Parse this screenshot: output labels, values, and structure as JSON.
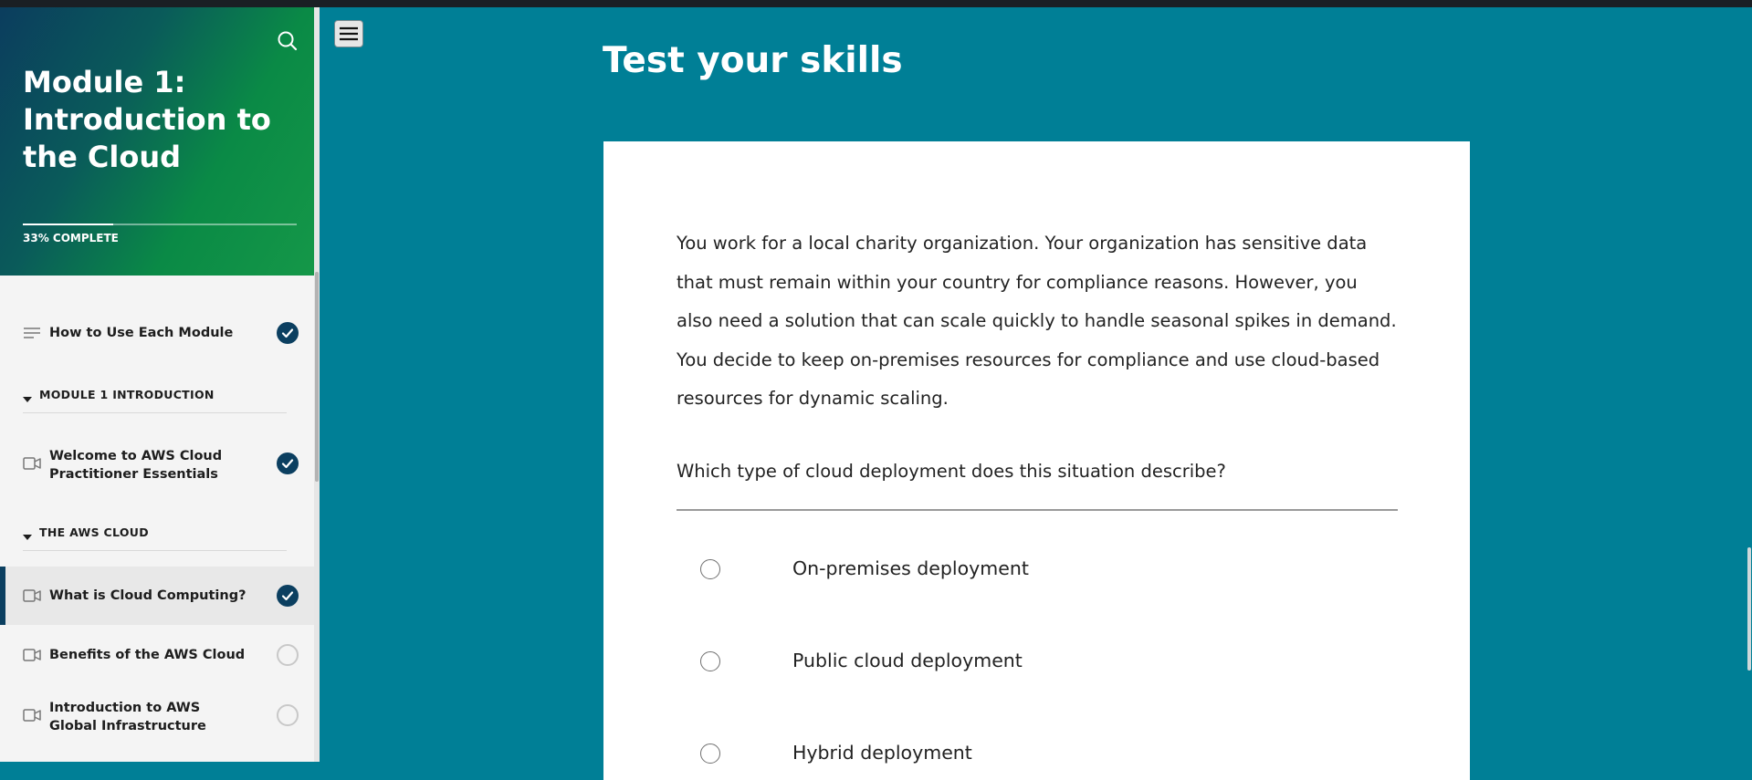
{
  "sidebar": {
    "module_title": "Module 1: Introduction to the Cloud",
    "progress_label": "33% COMPLETE",
    "progress_percent": 33,
    "items": [
      {
        "type": "lesson",
        "icon": "text-lines-icon",
        "label": "How to Use Each Module",
        "status": "complete"
      },
      {
        "type": "section",
        "label": "MODULE 1 INTRODUCTION"
      },
      {
        "type": "lesson",
        "icon": "video-icon",
        "label": "Welcome to AWS Cloud Practitioner Essentials",
        "status": "complete"
      },
      {
        "type": "section",
        "label": "THE AWS CLOUD"
      },
      {
        "type": "lesson",
        "icon": "video-icon",
        "label": "What is Cloud Computing?",
        "status": "complete",
        "active": true
      },
      {
        "type": "lesson",
        "icon": "video-icon",
        "label": "Benefits of the AWS Cloud",
        "status": "incomplete"
      },
      {
        "type": "lesson",
        "icon": "video-icon",
        "label": "Introduction to AWS Global Infrastructure",
        "status": "incomplete"
      }
    ]
  },
  "main": {
    "title": "Test your skills",
    "question": "You work for a local charity organization. Your organization has sensitive data that must remain within your country for compliance reasons. However, you also need a solution that can scale quickly to handle seasonal spikes in demand. You decide to keep on-premises resources for compliance and use cloud-based resources for dynamic scaling.",
    "prompt": "Which type of cloud deployment does this situation describe?",
    "options": [
      {
        "label": "On-premises deployment"
      },
      {
        "label": "Public cloud deployment"
      },
      {
        "label": "Hybrid deployment"
      }
    ]
  },
  "colors": {
    "page_background": "#007f96",
    "complete_check": "#0b3f60",
    "sidebar_background": "#f4f4f4"
  }
}
